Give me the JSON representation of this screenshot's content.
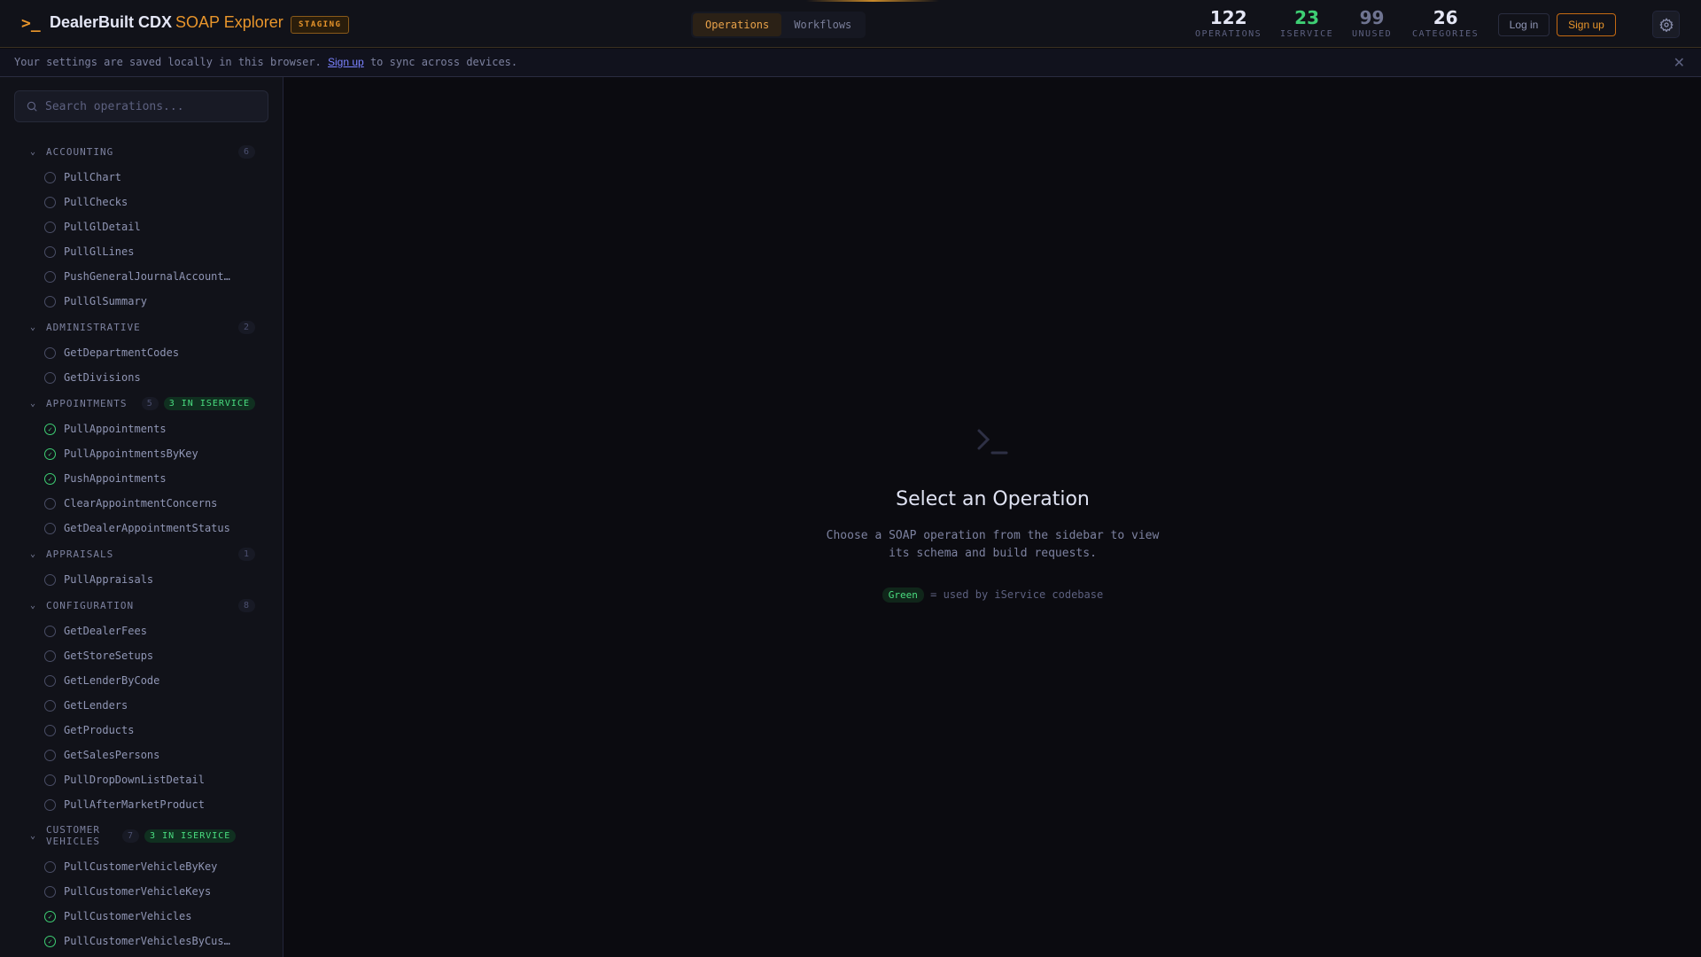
{
  "header": {
    "title": "DealerBuilt CDX",
    "subtitle": "SOAP Explorer",
    "env_badge": "STAGING",
    "tabs": [
      {
        "label": "Operations",
        "active": true
      },
      {
        "label": "Workflows",
        "active": false
      }
    ],
    "stats": [
      {
        "value": "122",
        "label": "OPERATIONS",
        "color": "#e4e6f5"
      },
      {
        "value": "23",
        "label": "ISERVICE",
        "color": "#3ecf74"
      },
      {
        "value": "99",
        "label": "UNUSED",
        "color": "#6f7491"
      },
      {
        "value": "26",
        "label": "CATEGORIES",
        "color": "#e4e6f5"
      }
    ],
    "login": "Log in",
    "signup": "Sign up"
  },
  "banner": {
    "before": "Your settings are saved locally in this browser.",
    "link": "Sign up",
    "after": "to sync across devices."
  },
  "sidebar": {
    "search_placeholder": "Search operations...",
    "categories": [
      {
        "name": "ACCOUNTING",
        "count": "6",
        "iservice": null,
        "items": [
          {
            "name": "PullChart",
            "ok": false
          },
          {
            "name": "PullChecks",
            "ok": false
          },
          {
            "name": "PullGlDetail",
            "ok": false
          },
          {
            "name": "PullGlLines",
            "ok": false
          },
          {
            "name": "PushGeneralJournalAccounting",
            "ok": false
          },
          {
            "name": "PullGlSummary",
            "ok": false
          }
        ]
      },
      {
        "name": "ADMINISTRATIVE",
        "count": "2",
        "iservice": null,
        "items": [
          {
            "name": "GetDepartmentCodes",
            "ok": false
          },
          {
            "name": "GetDivisions",
            "ok": false
          }
        ]
      },
      {
        "name": "APPOINTMENTS",
        "count": "5",
        "iservice": "3 IN ISERVICE",
        "items": [
          {
            "name": "PullAppointments",
            "ok": true
          },
          {
            "name": "PullAppointmentsByKey",
            "ok": true
          },
          {
            "name": "PushAppointments",
            "ok": true
          },
          {
            "name": "ClearAppointmentConcerns",
            "ok": false
          },
          {
            "name": "GetDealerAppointmentStatus",
            "ok": false
          }
        ]
      },
      {
        "name": "APPRAISALS",
        "count": "1",
        "iservice": null,
        "items": [
          {
            "name": "PullAppraisals",
            "ok": false
          }
        ]
      },
      {
        "name": "CONFIGURATION",
        "count": "8",
        "iservice": null,
        "items": [
          {
            "name": "GetDealerFees",
            "ok": false
          },
          {
            "name": "GetStoreSetups",
            "ok": false
          },
          {
            "name": "GetLenderByCode",
            "ok": false
          },
          {
            "name": "GetLenders",
            "ok": false
          },
          {
            "name": "GetProducts",
            "ok": false
          },
          {
            "name": "GetSalesPersons",
            "ok": false
          },
          {
            "name": "PullDropDownListDetail",
            "ok": false
          },
          {
            "name": "PullAfterMarketProduct",
            "ok": false
          }
        ]
      },
      {
        "name": "CUSTOMER VEHICLES",
        "count": "7",
        "iservice": "3 IN ISERVICE",
        "items": [
          {
            "name": "PullCustomerVehicleByKey",
            "ok": false
          },
          {
            "name": "PullCustomerVehicleKeys",
            "ok": false
          },
          {
            "name": "PullCustomerVehicles",
            "ok": true
          },
          {
            "name": "PullCustomerVehiclesByCustomer",
            "ok": true
          }
        ]
      }
    ]
  },
  "main": {
    "title": "Select an Operation",
    "desc_line1": "Choose a SOAP operation from the sidebar to view",
    "desc_line2": "its schema and build requests.",
    "legend_pill": "Green",
    "legend_text": "= used by iService codebase"
  }
}
